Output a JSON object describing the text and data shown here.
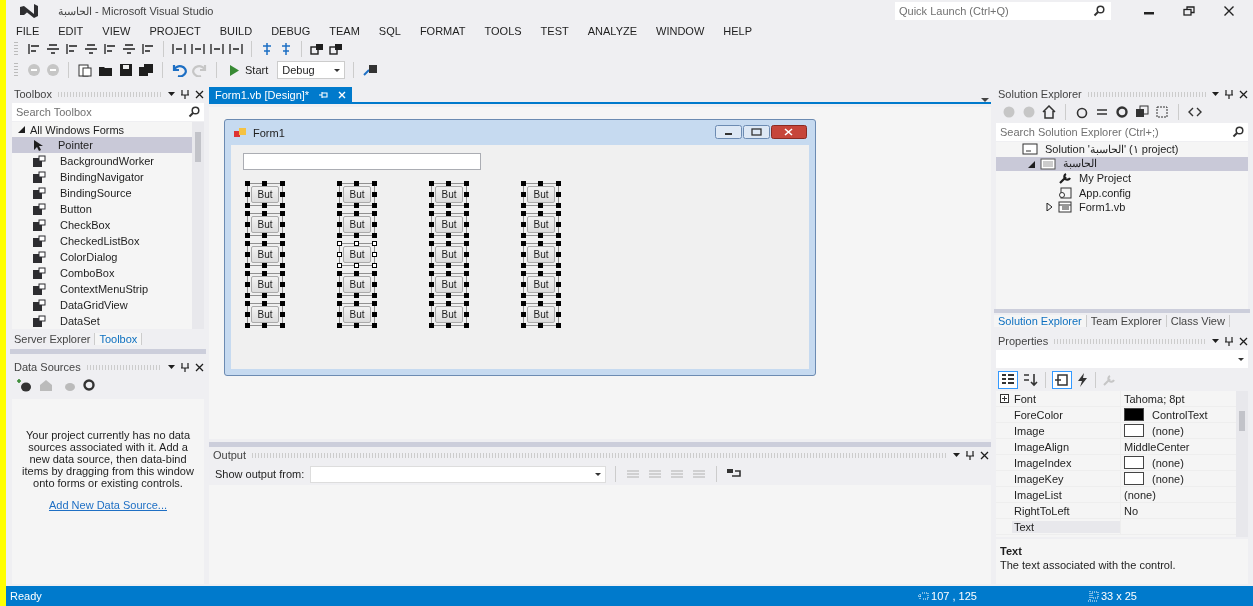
{
  "window": {
    "title": "الحاسبة - Microsoft Visual Studio"
  },
  "quick_launch": {
    "placeholder": "Quick Launch (Ctrl+Q)"
  },
  "menu": [
    "FILE",
    "EDIT",
    "VIEW",
    "PROJECT",
    "BUILD",
    "DEBUG",
    "TEAM",
    "SQL",
    "FORMAT",
    "TOOLS",
    "TEST",
    "ANALYZE",
    "WINDOW",
    "HELP"
  ],
  "toolbar": {
    "start": "Start",
    "configuration": "Debug"
  },
  "toolbox": {
    "title": "Toolbox",
    "search_placeholder": "Search Toolbox",
    "group": {
      "label": "All Windows Forms",
      "expanded": true
    },
    "items": [
      {
        "label": "Pointer",
        "selected": true
      },
      {
        "label": "BackgroundWorker",
        "selected": false
      },
      {
        "label": "BindingNavigator",
        "selected": false
      },
      {
        "label": "BindingSource",
        "selected": false
      },
      {
        "label": "Button",
        "selected": false
      },
      {
        "label": "CheckBox",
        "selected": false
      },
      {
        "label": "CheckedListBox",
        "selected": false
      },
      {
        "label": "ColorDialog",
        "selected": false
      },
      {
        "label": "ComboBox",
        "selected": false
      },
      {
        "label": "ContextMenuStrip",
        "selected": false
      },
      {
        "label": "DataGridView",
        "selected": false
      },
      {
        "label": "DataSet",
        "selected": false
      }
    ],
    "tabs": [
      {
        "label": "Server Explorer",
        "selected": false
      },
      {
        "label": "Toolbox",
        "selected": true
      }
    ]
  },
  "data_sources": {
    "title": "Data Sources",
    "message": "Your project currently has no data sources associated with it. Add a new data source, then data-bind items by dragging from this window onto forms or existing controls.",
    "link": "Add New Data Source..."
  },
  "editor_tabs": [
    {
      "label": "Form1.vb [Design]*",
      "selected": true
    }
  ],
  "form": {
    "title": "Form1",
    "columns": [
      [
        {
          "label": "But",
          "primary": false
        },
        {
          "label": "But",
          "primary": false
        },
        {
          "label": "But",
          "primary": false
        },
        {
          "label": "But",
          "primary": false
        },
        {
          "label": "But",
          "primary": false
        }
      ],
      [
        {
          "label": "But",
          "primary": false
        },
        {
          "label": "But",
          "primary": false
        },
        {
          "label": "But",
          "primary": true
        },
        {
          "label": "But",
          "primary": false
        },
        {
          "label": "But",
          "primary": false
        }
      ],
      [
        {
          "label": "But",
          "primary": false
        },
        {
          "label": "But",
          "primary": false
        },
        {
          "label": "But",
          "primary": false
        },
        {
          "label": "But",
          "primary": false
        },
        {
          "label": "But",
          "primary": false
        }
      ],
      [
        {
          "label": "But",
          "primary": false
        },
        {
          "label": "But",
          "primary": false
        },
        {
          "label": "But",
          "primary": false
        },
        {
          "label": "But",
          "primary": false
        },
        {
          "label": "But",
          "primary": false
        }
      ]
    ]
  },
  "output": {
    "title": "Output",
    "source_label": "Show output from:"
  },
  "solution_explorer": {
    "title": "Solution Explorer",
    "search_placeholder": "Search Solution Explorer (Ctrl+;)",
    "tree": [
      {
        "label": "Solution 'الحاسبة' (١ project)",
        "kind": "solution",
        "selected": false,
        "children": [
          {
            "label": "الحاسبة",
            "kind": "project",
            "selected": true,
            "expanded": true,
            "children": [
              {
                "label": "My Project",
                "kind": "settings",
                "selected": false
              },
              {
                "label": "App.config",
                "kind": "config",
                "selected": false
              },
              {
                "label": "Form1.vb",
                "kind": "form",
                "selected": false,
                "expanded": false
              }
            ]
          }
        ]
      }
    ],
    "tabs": [
      {
        "label": "Solution Explorer",
        "selected": true
      },
      {
        "label": "Team Explorer",
        "selected": false
      },
      {
        "label": "Class View",
        "selected": false
      }
    ]
  },
  "properties": {
    "title": "Properties",
    "rows": [
      {
        "name": "Font",
        "value": "Tahoma; 8pt",
        "kind": "group",
        "selected": false
      },
      {
        "name": "ForeColor",
        "value": "ControlText",
        "kind": "color",
        "color": "#000000",
        "selected": false
      },
      {
        "name": "Image",
        "value": "(none)",
        "kind": "swatch",
        "selected": false
      },
      {
        "name": "ImageAlign",
        "value": "MiddleCenter",
        "kind": "plain",
        "selected": false
      },
      {
        "name": "ImageIndex",
        "value": "(none)",
        "kind": "swatch",
        "selected": false
      },
      {
        "name": "ImageKey",
        "value": "(none)",
        "kind": "swatch",
        "selected": false
      },
      {
        "name": "ImageList",
        "value": "(none)",
        "kind": "plain",
        "selected": false
      },
      {
        "name": "RightToLeft",
        "value": "No",
        "kind": "plain",
        "selected": false
      },
      {
        "name": "Text",
        "kind": "plain",
        "selected": true
      }
    ],
    "description_title": "Text",
    "description": "The text associated with the control."
  },
  "status_bar": {
    "text": "Ready",
    "position": "107 , 125",
    "size": "33 x 25"
  }
}
